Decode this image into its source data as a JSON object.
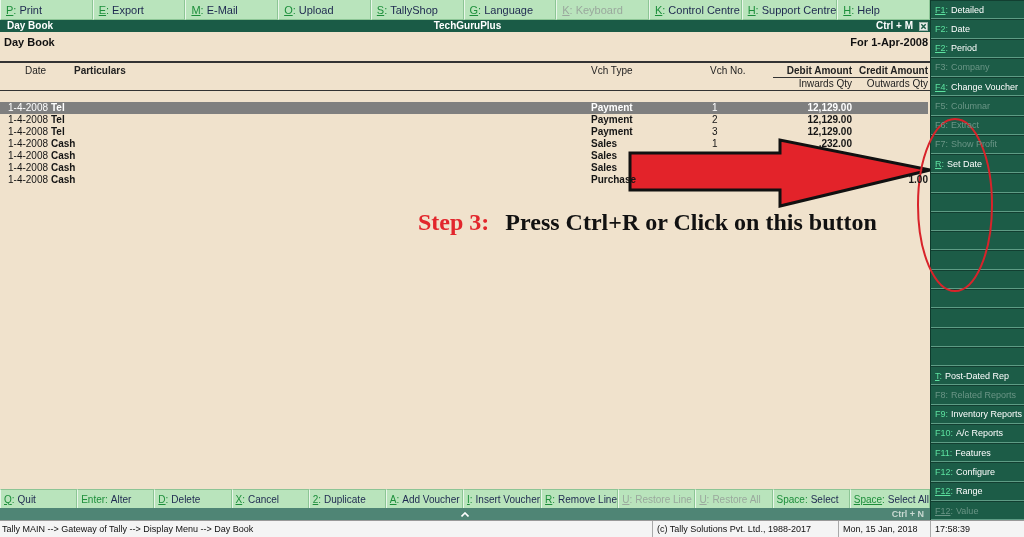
{
  "top_buttons": [
    {
      "key": "P:",
      "label": "Print",
      "underlined": true,
      "disabled": false
    },
    {
      "key": "E:",
      "label": "Export",
      "underlined": true,
      "disabled": false
    },
    {
      "key": "M:",
      "label": "E-Mail",
      "underlined": true,
      "disabled": false
    },
    {
      "key": "O:",
      "label": "Upload",
      "underlined": true,
      "disabled": false
    },
    {
      "key": "S:",
      "label": "TallyShop",
      "underlined": true,
      "disabled": false
    },
    {
      "key": "G:",
      "label": "Language",
      "underlined": true,
      "disabled": false
    },
    {
      "key": "K:",
      "label": "Keyboard",
      "underlined": true,
      "disabled": true
    },
    {
      "key": "K:",
      "label": "Control Centre",
      "underlined": true,
      "disabled": false
    },
    {
      "key": "H:",
      "label": "Support Centre",
      "underlined": true,
      "disabled": false
    },
    {
      "key": "H:",
      "label": "Help",
      "underlined": true,
      "disabled": false
    }
  ],
  "title_bar": {
    "title": "Day Book",
    "company": "TechGuruPlus",
    "shortcut": "Ctrl + M"
  },
  "report": {
    "title": "Day Book",
    "period": "For 1-Apr-2008"
  },
  "columns": {
    "date": "Date",
    "particulars": "Particulars",
    "vch_type": "Vch Type",
    "vch_no": "Vch No.",
    "debit": "Debit Amount",
    "credit": "Credit Amount",
    "inwards": "Inwards Qty",
    "outwards": "Outwards Qty"
  },
  "rows": [
    {
      "date": "1-4-2008",
      "particulars": "Tel",
      "vch_type": "Payment",
      "vch_no": "1",
      "debit": "12,129.00",
      "selected": true
    },
    {
      "date": "1-4-2008",
      "particulars": "Tel",
      "vch_type": "Payment",
      "vch_no": "2",
      "debit": "12,129.00",
      "selected": false
    },
    {
      "date": "1-4-2008",
      "particulars": "Tel",
      "vch_type": "Payment",
      "vch_no": "3",
      "debit": "12,129.00",
      "selected": false
    },
    {
      "date": "1-4-2008",
      "particulars": "Cash",
      "vch_type": "Sales",
      "vch_no": "1",
      "debit": ",232.00",
      "selected": false
    },
    {
      "date": "1-4-2008",
      "particulars": "Cash",
      "vch_type": "Sales",
      "selected": false
    },
    {
      "date": "1-4-2008",
      "particulars": "Cash",
      "vch_type": "Sales",
      "selected": false
    },
    {
      "date": "1-4-2008",
      "particulars": "Cash",
      "vch_type": "Purchase",
      "credit": "1.00",
      "selected": false
    }
  ],
  "annotation": {
    "step": "Step 3:",
    "text": "Press Ctrl+R or Click on this button"
  },
  "side_buttons": [
    {
      "kind": "button",
      "key": "F1:",
      "label": "Detailed",
      "underlined": true,
      "disabled": false
    },
    {
      "kind": "button",
      "key": "F2:",
      "label": "Date",
      "underlined": false,
      "disabled": false
    },
    {
      "kind": "button",
      "key": "F2:",
      "label": "Period",
      "underlined": true,
      "disabled": false
    },
    {
      "kind": "button",
      "key": "F3:",
      "label": "Company",
      "underlined": false,
      "disabled": true
    },
    {
      "kind": "button",
      "key": "F4:",
      "label": "Change Voucher",
      "underlined": true,
      "disabled": false
    },
    {
      "kind": "button",
      "key": "F5:",
      "label": "Columnar",
      "underlined": false,
      "disabled": true
    },
    {
      "kind": "button",
      "key": "F6:",
      "label": "Extract",
      "underlined": false,
      "disabled": true
    },
    {
      "kind": "button",
      "key": "F7:",
      "label": "Show Profit",
      "underlined": false,
      "disabled": true
    },
    {
      "kind": "button",
      "key": "R:",
      "label": "Set Date",
      "underlined": true,
      "disabled": false
    },
    {
      "kind": "blank"
    },
    {
      "kind": "blank"
    },
    {
      "kind": "blank"
    },
    {
      "kind": "blank"
    },
    {
      "kind": "blank"
    },
    {
      "kind": "blank"
    },
    {
      "kind": "blank"
    },
    {
      "kind": "blank"
    },
    {
      "kind": "blank"
    },
    {
      "kind": "blank"
    },
    {
      "kind": "button",
      "key": "T:",
      "label": "Post-Dated Rep",
      "underlined": true,
      "disabled": false
    },
    {
      "kind": "button",
      "key": "F8:",
      "label": "Related Reports",
      "underlined": false,
      "disabled": true
    },
    {
      "kind": "button",
      "key": "F9:",
      "label": "Inventory Reports",
      "underlined": false,
      "disabled": false
    },
    {
      "kind": "button",
      "key": "F10:",
      "label": "A/c Reports",
      "underlined": false,
      "disabled": false
    },
    {
      "kind": "button",
      "key": "F11:",
      "label": "Features",
      "underlined": false,
      "disabled": false
    },
    {
      "kind": "button",
      "key": "F12:",
      "label": "Configure",
      "underlined": false,
      "disabled": false
    },
    {
      "kind": "button",
      "key": "F12:",
      "label": "Range",
      "underlined": true,
      "disabled": false
    },
    {
      "kind": "button",
      "key": "F12:",
      "label": "Value",
      "underlined": true,
      "disabled": true
    }
  ],
  "bottom_buttons": [
    {
      "key": "Q:",
      "label": "Quit",
      "underlined": true,
      "disabled": false
    },
    {
      "key": "Enter:",
      "label": "Alter",
      "underlined": false,
      "disabled": false
    },
    {
      "key": "D:",
      "label": "Delete",
      "underlined": true,
      "disabled": false
    },
    {
      "key": "X:",
      "label": "Cancel",
      "underlined": true,
      "disabled": false
    },
    {
      "key": "2:",
      "label": "Duplicate",
      "underlined": true,
      "disabled": false
    },
    {
      "key": "A:",
      "label": "Add Voucher",
      "underlined": true,
      "disabled": false
    },
    {
      "key": "I:",
      "label": "Insert Voucher",
      "underlined": true,
      "disabled": false
    },
    {
      "key": "R:",
      "label": "Remove Line",
      "underlined": true,
      "disabled": false
    },
    {
      "key": "U:",
      "label": "Restore Line",
      "underlined": true,
      "disabled": true
    },
    {
      "key": "U:",
      "label": "Restore All",
      "underlined": true,
      "disabled": true
    },
    {
      "key": "Space:",
      "label": "Select",
      "underlined": false,
      "disabled": false
    },
    {
      "key": "Space:",
      "label": "Select All",
      "underlined": true,
      "disabled": false
    }
  ],
  "bottom_strip": {
    "shortcut": "Ctrl + N"
  },
  "status_bar": {
    "path": "Tally MAIN --> Gateway of Tally --> Display Menu --> Day Book",
    "copyright": "(c) Tally Solutions Pvt. Ltd., 1988-2017",
    "date": "Mon, 15 Jan, 2018",
    "time": "17:58:39"
  }
}
